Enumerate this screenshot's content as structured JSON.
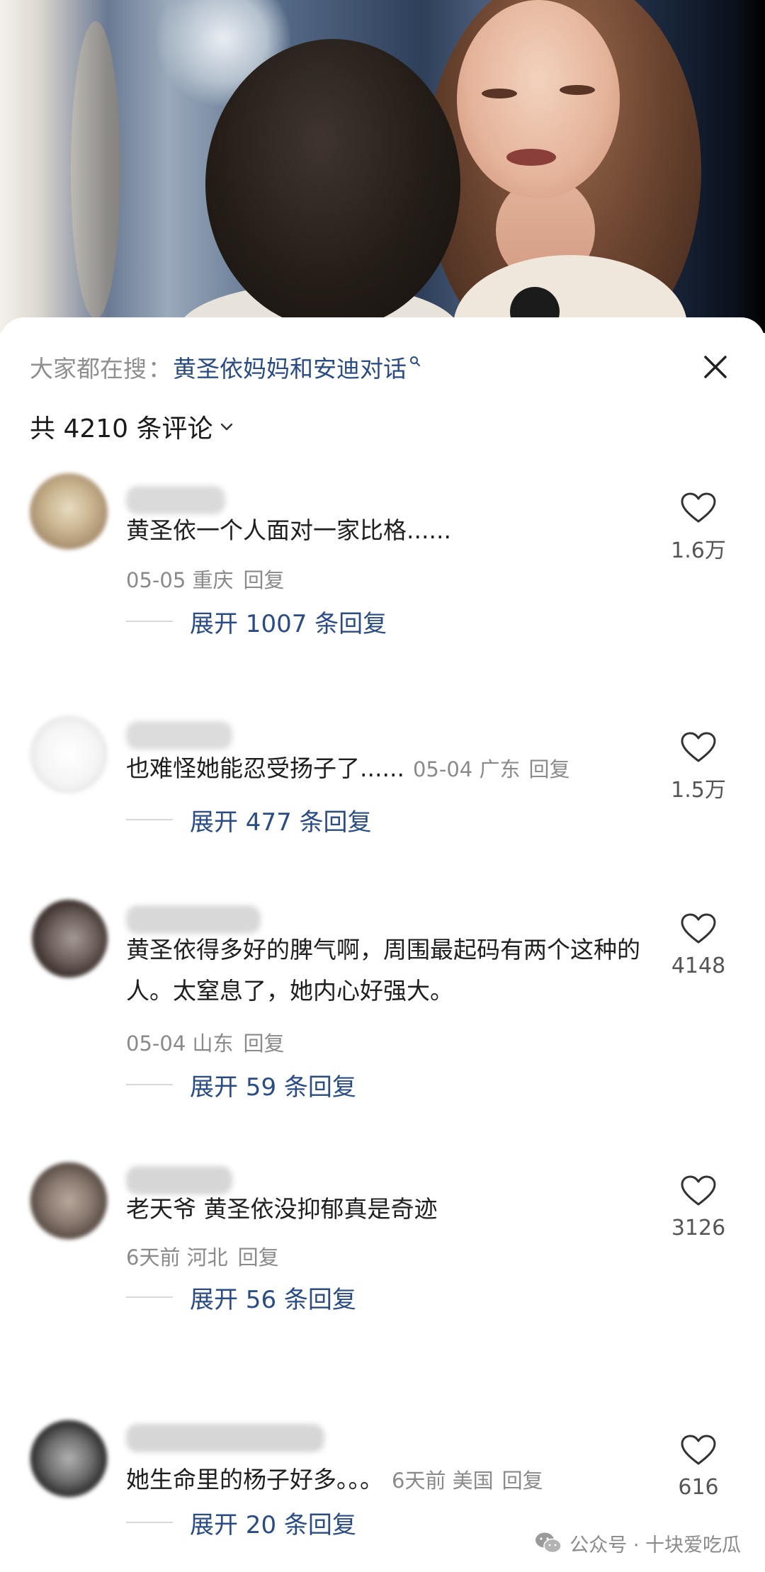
{
  "search": {
    "prefix": "大家都在搜",
    "colon": "：",
    "term": "黄圣依妈妈和安迪对话"
  },
  "comments_header": {
    "count_label": "共 4210 条评论"
  },
  "comments": [
    {
      "text": "黄圣依一个人面对一家比格......",
      "meta": "05-05 重庆",
      "reply_label": "回复",
      "likes": "1.6万",
      "expand": "展开 1007 条回复"
    },
    {
      "text": "也难怪她能忍受扬子了......",
      "meta": "05-04 广东",
      "reply_label": "回复",
      "likes": "1.5万",
      "expand": "展开 477 条回复"
    },
    {
      "text": "黄圣依得多好的脾气啊，周围最起码有两个这种的人。太窒息了，她内心好强大。",
      "meta": "05-04 山东",
      "reply_label": "回复",
      "likes": "4148",
      "expand": "展开 59 条回复"
    },
    {
      "text": "老天爷 黄圣依没抑郁真是奇迹",
      "meta": "6天前 河北",
      "reply_label": "回复",
      "likes": "3126",
      "expand": "展开 56 条回复"
    },
    {
      "text": "她生命里的杨子好多。。。",
      "meta": "6天前 美国",
      "reply_label": "回复",
      "likes": "616",
      "expand": "展开 20 条回复"
    }
  ],
  "watermark": {
    "text": "公众号 · 十块爱吃瓜"
  },
  "colors": {
    "link_blue": "#2a4c86",
    "meta_gray": "#8a8a8a",
    "text_dark": "#1f1f1f"
  },
  "icons": [
    "search-icon",
    "close-icon",
    "chevron-down-icon",
    "heart-icon",
    "wechat-icon"
  ]
}
